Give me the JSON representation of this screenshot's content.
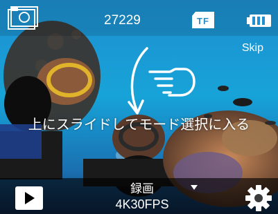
{
  "top_bar": {
    "counter": "27229",
    "storage_label": "TF",
    "icons": [
      "photo-mode-icon",
      "tf-card-icon",
      "battery-icon"
    ]
  },
  "skip_label": "Skip",
  "hint_text": "上にスライドしてモード選択に入る",
  "gesture_icons": [
    "swipe-up-arrow-icon",
    "pointing-hand-icon"
  ],
  "bottom_bar": {
    "mode_name": "録画",
    "mode_resolution": "4K30FPS",
    "icons": [
      "play-icon",
      "dropdown-caret-icon",
      "gear-icon"
    ]
  },
  "colors": {
    "text": "#ffffff",
    "tf_text": "#2a8fc4",
    "bottom_bar": "#000000"
  }
}
